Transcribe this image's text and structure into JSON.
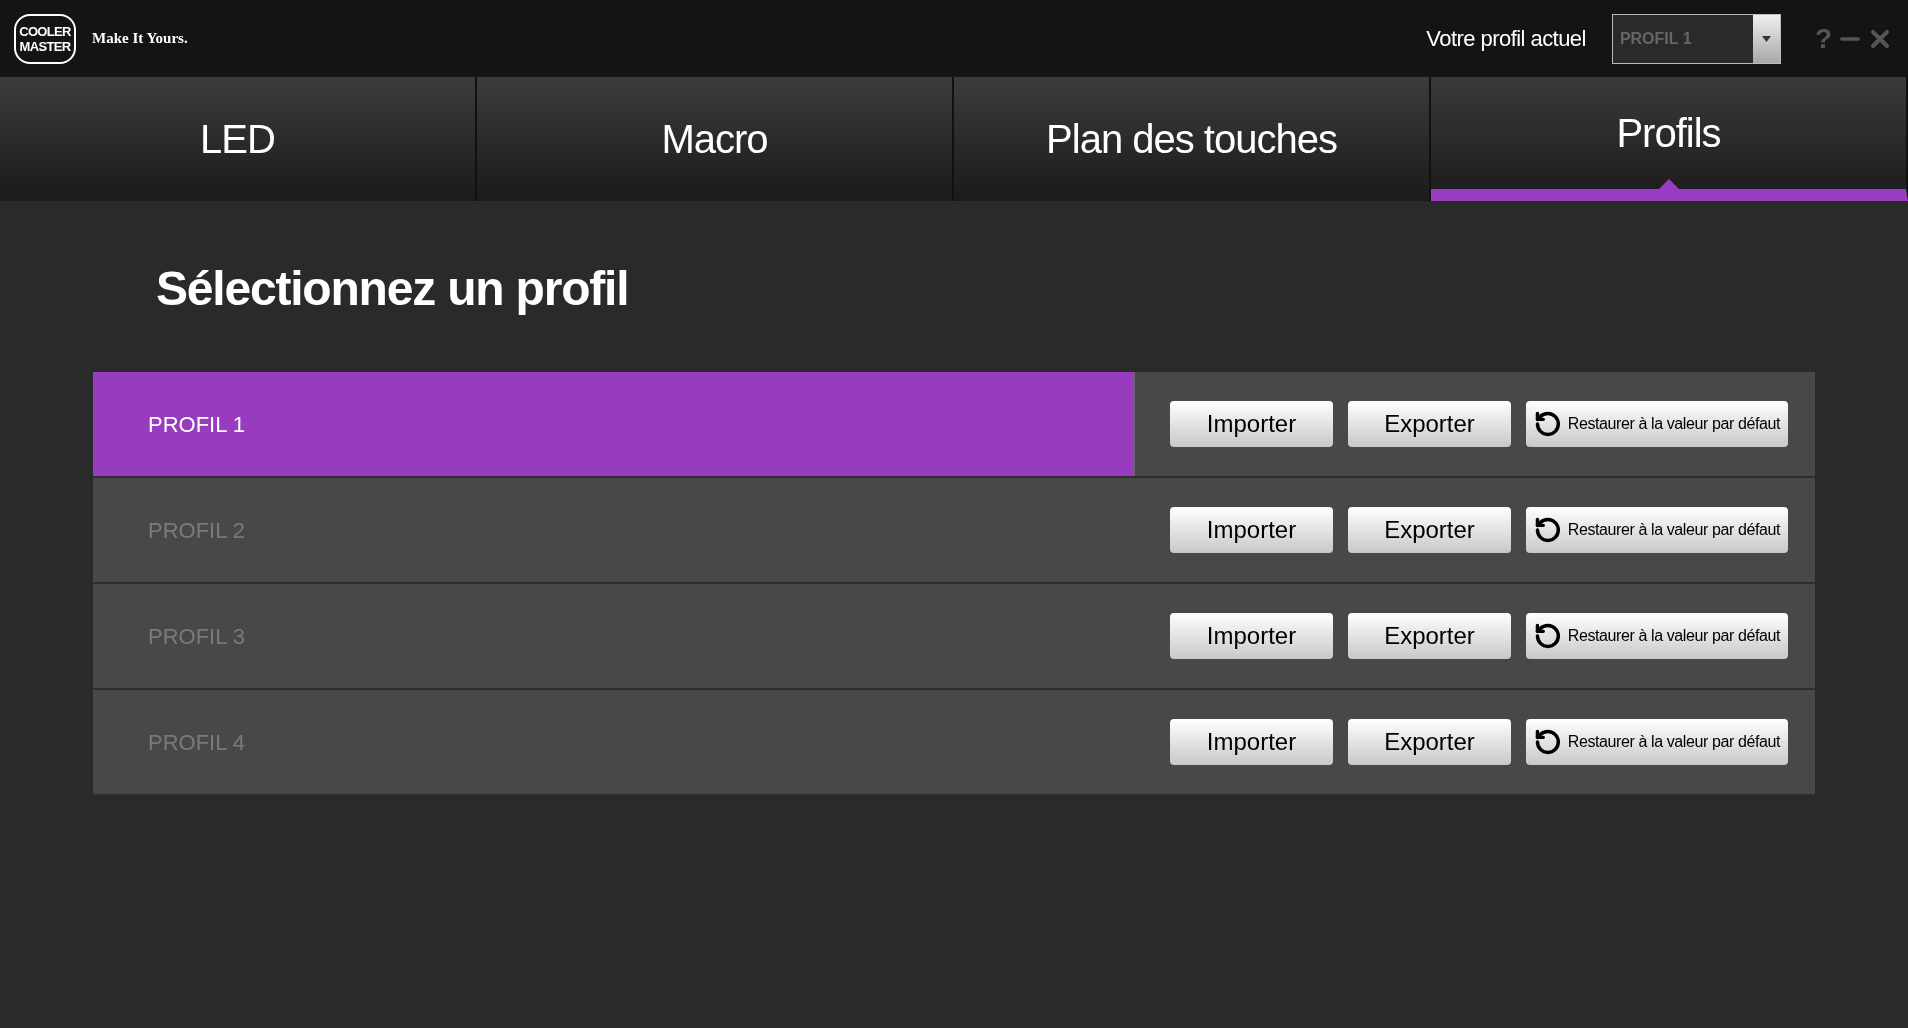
{
  "header": {
    "logo": [
      "COOLER",
      "MASTER"
    ],
    "tagline": "Make It Yours.",
    "profile_label": "Votre profil actuel",
    "profile_select": {
      "value": "PROFIL 1"
    },
    "help": "?"
  },
  "tabs": [
    {
      "label": "LED",
      "selected": false
    },
    {
      "label": "Macro",
      "selected": false
    },
    {
      "label": "Plan des touches",
      "selected": false
    },
    {
      "label": "Profils",
      "selected": true
    }
  ],
  "heading": "Sélectionnez un profil",
  "profiles": [
    {
      "name": "PROFIL 1",
      "selected": true,
      "buttons": [
        "Importer",
        "Exporter",
        "Restaurer à la valeur par défaut"
      ]
    },
    {
      "name": "PROFIL 2",
      "selected": false,
      "buttons": [
        "Importer",
        "Exporter",
        "Restaurer à la valeur par défaut"
      ]
    },
    {
      "name": "PROFIL 3",
      "selected": false,
      "buttons": [
        "Importer",
        "Exporter",
        "Restaurer à la valeur par défaut"
      ]
    },
    {
      "name": "PROFIL 4",
      "selected": false,
      "buttons": [
        "Importer",
        "Exporter",
        "Restaurer à la valeur par défaut"
      ]
    }
  ]
}
